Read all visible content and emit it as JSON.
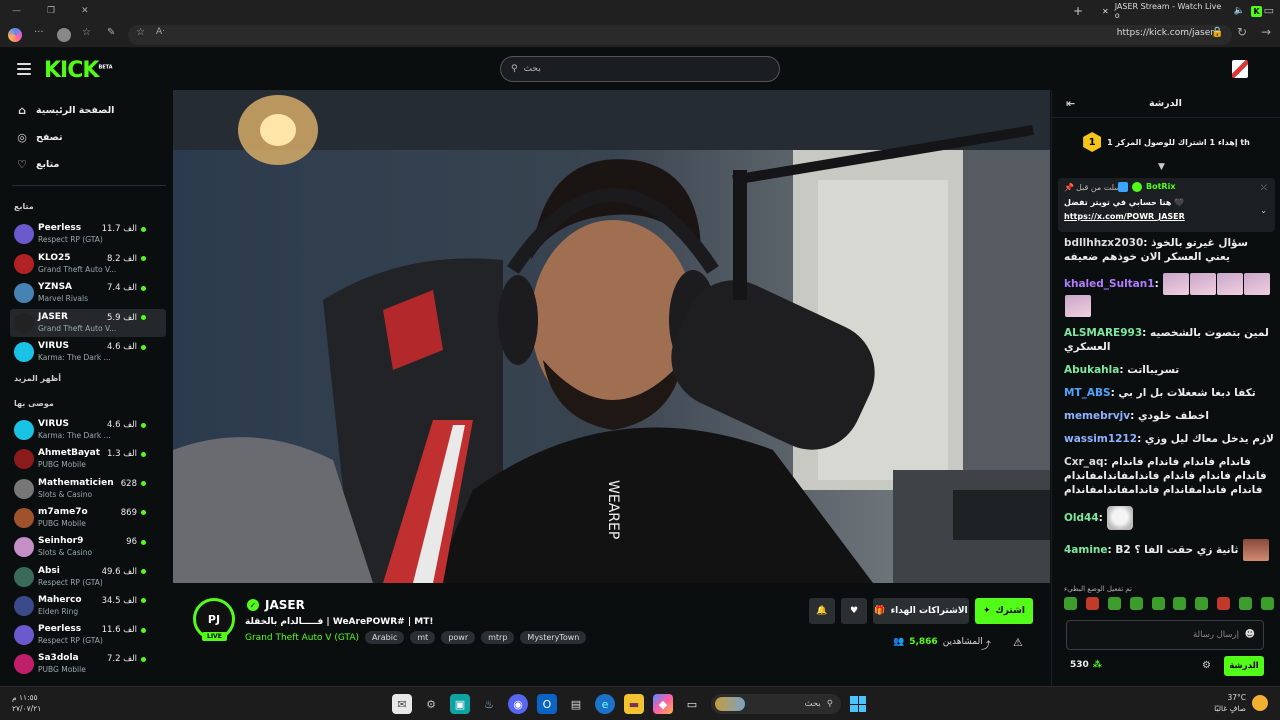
{
  "browser": {
    "tab_title": "JASER Stream - Watch Live o",
    "url": "https://kick.com/jaser"
  },
  "header": {
    "logo": "KICK",
    "logo_badge": "BETA",
    "search_placeholder": "بحث"
  },
  "sidebar": {
    "nav": [
      {
        "label": "الصفحة الرئيسية",
        "icon": "home-icon"
      },
      {
        "label": "تصفح",
        "icon": "compass-icon"
      },
      {
        "label": "متابع",
        "icon": "heart-icon"
      }
    ],
    "following_title": "متابع",
    "following": [
      {
        "name": "Peerless",
        "game": "Respect RP (GTA)",
        "viewers": "11.7 الف",
        "color": "#6a5acd"
      },
      {
        "name": "KLO25",
        "game": "Grand Theft Auto V...",
        "viewers": "8.2 الف",
        "color": "#b22222"
      },
      {
        "name": "YZNSA",
        "game": "Marvel Rivals",
        "viewers": "7.4 الف",
        "color": "#4682b4"
      },
      {
        "name": "JASER",
        "game": "Grand Theft Auto V...",
        "viewers": "5.9 الف",
        "color": "#222222"
      },
      {
        "name": "VIRUS",
        "game": "Karma: The Dark ...",
        "viewers": "4.6 الف",
        "color": "#19c3e6"
      }
    ],
    "show_more": "أظهر المزيد",
    "recommended_title": "موصى بها",
    "recommended": [
      {
        "name": "VIRUS",
        "game": "Karma: The Dark ...",
        "viewers": "4.6 الف",
        "color": "#19c3e6"
      },
      {
        "name": "AhmetBayat",
        "game": "PUBG Mobile",
        "viewers": "1.3 الف",
        "color": "#8b1a1a"
      },
      {
        "name": "Mathematicien",
        "game": "Slots & Casino",
        "viewers": "628",
        "color": "#777777"
      },
      {
        "name": "m7ame7o",
        "game": "PUBG Mobile",
        "viewers": "869",
        "color": "#a0522d"
      },
      {
        "name": "Seinhor9",
        "game": "Slots & Casino",
        "viewers": "96",
        "color": "#c48fc4"
      },
      {
        "name": "Absi",
        "game": "Respect RP (GTA)",
        "viewers": "49.6 الف",
        "color": "#3a6b5a"
      },
      {
        "name": "Maherco",
        "game": "Elden Ring",
        "viewers": "34.5 الف",
        "color": "#3b4a8a"
      },
      {
        "name": "Peerless",
        "game": "Respect RP (GTA)",
        "viewers": "11.6 الف",
        "color": "#6a5acd"
      },
      {
        "name": "Sa3dola",
        "game": "PUBG Mobile",
        "viewers": "7.2 الف",
        "color": "#c0206a"
      }
    ]
  },
  "channel": {
    "name": "JASER",
    "live": "LIVE",
    "title": "فـــــالدام بالخقلة | WeArePOWR# | MT!",
    "category": "Grand Theft Auto V (GTA)",
    "tags": [
      "Arabic",
      "mt",
      "powr",
      "mtrp",
      "MysteryTown"
    ],
    "subscribe": "اشترك",
    "gift_subs": "الاشتراكات الهداء",
    "viewers_label": "المشاهدين",
    "viewers": "5,866"
  },
  "chat": {
    "title": "الدرشة",
    "goal_num": "1",
    "goal_text": "إهداء 1 اشتراك للوصول المركز 1 th",
    "pinned_by": "BotRix",
    "pinned_note": "أرسلت من قبل",
    "pinned_text": "هنا حسابي في تويتر تفضل 🖤",
    "pinned_link": "https://x.com/POWR_JASER",
    "messages": [
      {
        "user": "bdllhhzx2030",
        "color": "#dddddd",
        "text": "سؤال غيرتو بالخوذ يعني العسكر الان خوذهم ضعيفه"
      },
      {
        "user": "khaled_Sultan1",
        "color": "#b07cff",
        "text": ""
      },
      {
        "user": "ALSMARE993",
        "color": "#7ee8a0",
        "text": "لمين بتصوت بالشخصيه العسكري"
      },
      {
        "user": "Abukahla",
        "color": "#7ee8a0",
        "text": "تسريبااتت"
      },
      {
        "user": "MT_ABS",
        "color": "#4ea4ff",
        "text": "تكفا دبغا شعغلات بل ار بي"
      },
      {
        "user": "memebrvjv",
        "color": "#8fb3ff",
        "text": "اخطف خلودي"
      },
      {
        "user": "wassim1212",
        "color": "#8fb3ff",
        "text": "لازم يدخل معاك ليل وزي"
      },
      {
        "user": "Cxr_aq",
        "color": "#dddddd",
        "text": "فاندام فاندام فاندام فاندام فاندام فاندام فاندام فاندامفاندامفاندام فاندام فاندامفاندام فاندامفاندامفاندام"
      },
      {
        "user": "Old44",
        "color": "#7ee8a0",
        "text": ""
      },
      {
        "user": "4amine",
        "color": "#7ee8a0",
        "text": "B2 ثانية زي حقت الفا ؟"
      }
    ],
    "emote_hint": "تم تفعيل الوضع البطيء",
    "input_placeholder": "إرسال رسالة",
    "send": "الدرشة",
    "points": "530"
  },
  "taskbar": {
    "time": "١١:٥٥ م",
    "date": "٢٧/٠٧/٢١",
    "search": "بحث",
    "weather_temp": "37°C",
    "weather_desc": "صافٍ غالبًا"
  }
}
